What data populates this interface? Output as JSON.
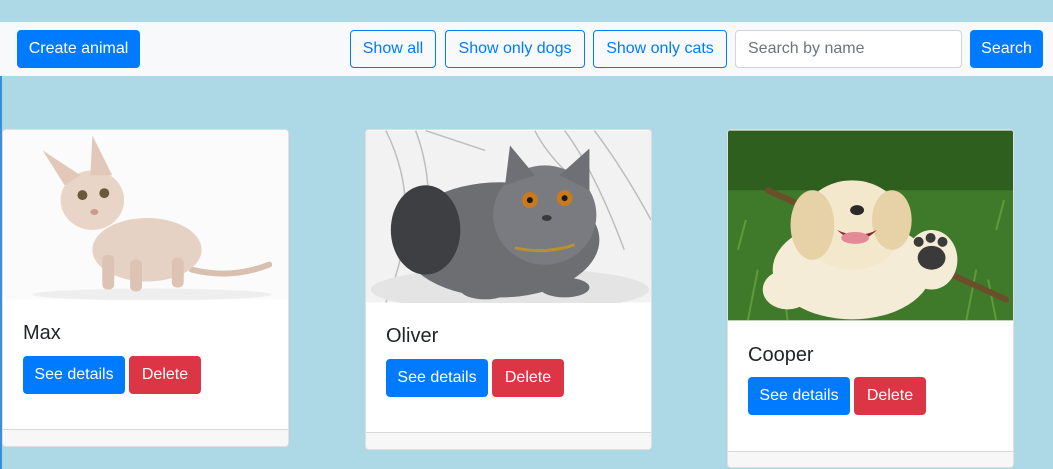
{
  "navbar": {
    "create_label": "Create animal",
    "filters": [
      "Show all",
      "Show only dogs",
      "Show only cats"
    ],
    "search_placeholder": "Search by name",
    "search_label": "Search"
  },
  "cards": [
    {
      "name": "Max",
      "details_label": "See details",
      "delete_label": "Delete"
    },
    {
      "name": "Oliver",
      "details_label": "See details",
      "delete_label": "Delete"
    },
    {
      "name": "Cooper",
      "details_label": "See details",
      "delete_label": "Delete"
    }
  ],
  "colors": {
    "page_background": "#add8e6",
    "primary": "#007bff",
    "danger": "#dc3545",
    "navbar_background": "#f8f9fa"
  }
}
